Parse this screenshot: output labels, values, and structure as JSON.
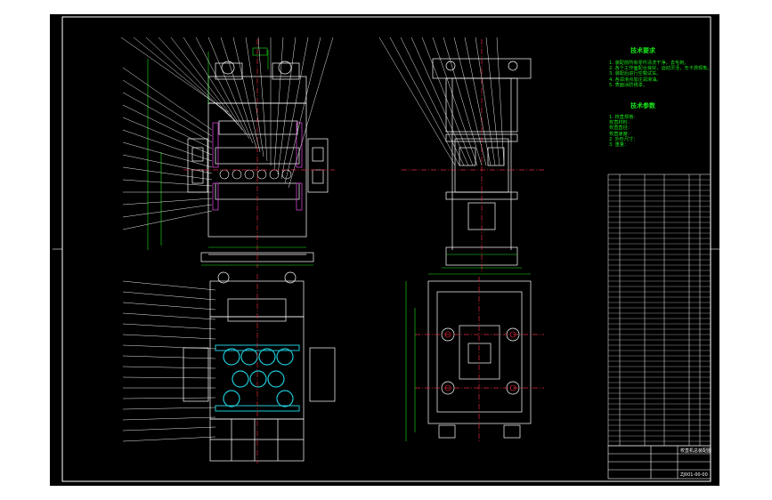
{
  "drawing": {
    "tech_requirements_heading": "技术要求",
    "tech_requirements": [
      "1. 装配前所有零件清洗干净，去毛刺。",
      "2. 各个工作面配合良好，运动灵活，无卡滞现象。",
      "3. 装配后进行空载试车。",
      "4. 各润滑点加注润滑油。",
      "5. 表面涂防锈漆。"
    ],
    "tech_params_heading": "技术参数",
    "tech_params": [
      "1. 校直规格:",
      "   校直材料：",
      "   校直直径：",
      "   校直速度：",
      "2. 外形尺寸：",
      "3. 重量："
    ],
    "title_block": {
      "name": "校直机总装配图",
      "code": "ZJ001-00-00"
    }
  },
  "colors": {
    "background": "#000000",
    "frame": "#ffffff",
    "structure": "#ffffff",
    "centerline": "#e0283a",
    "dimension": "#19e619",
    "rollers": "#1fc8d8",
    "hatch": "#d040d0"
  }
}
